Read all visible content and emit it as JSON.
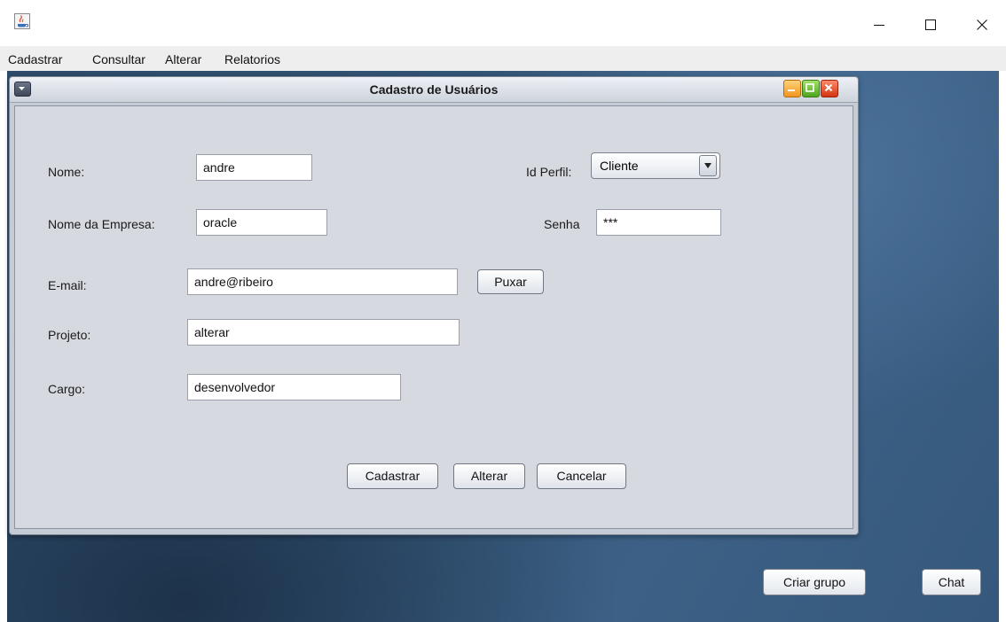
{
  "menubar": {
    "items": [
      {
        "label": "Cadastrar"
      },
      {
        "label": "Consultar"
      },
      {
        "label": "Alterar"
      },
      {
        "label": "Relatorios"
      }
    ]
  },
  "internal_frame": {
    "title": "Cadastro de Usuários",
    "form": {
      "nome": {
        "label": "Nome:",
        "value": "andre"
      },
      "empresa": {
        "label": "Nome da Empresa:",
        "value": "oracle"
      },
      "email": {
        "label": "E-mail:",
        "value": "andre@ribeiro"
      },
      "projeto": {
        "label": "Projeto:",
        "value": "alterar"
      },
      "cargo": {
        "label": "Cargo:",
        "value": "desenvolvedor"
      },
      "perfil": {
        "label": "Id Perfil:",
        "selected": "Cliente"
      },
      "senha": {
        "label": "Senha",
        "value": "***"
      },
      "puxar_label": "Puxar"
    },
    "actions": {
      "cadastrar_label": "Cadastrar",
      "alterar_label": "Alterar",
      "cancelar_label": "Cancelar"
    }
  },
  "desktop_buttons": {
    "criar_grupo_label": "Criar grupo",
    "chat_label": "Chat"
  },
  "icons": {
    "app": "java-cup-icon",
    "window_minimize": "minimize-icon",
    "window_maximize": "maximize-icon",
    "window_close": "close-icon",
    "frame_system_menu": "chevron-down-icon",
    "combo_arrow": "chevron-down-icon"
  },
  "colors": {
    "desktop": "#345779",
    "frame_background": "#d6d9df"
  }
}
